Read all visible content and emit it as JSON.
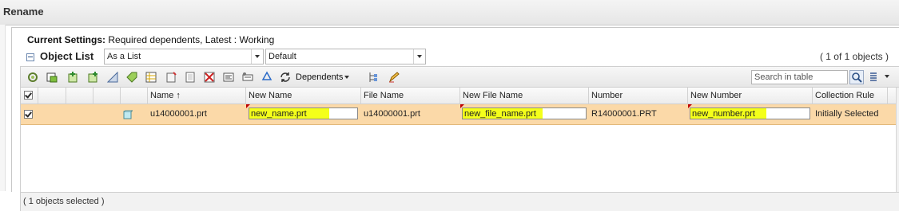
{
  "window": {
    "title": "Rename"
  },
  "settings": {
    "label": "Current Settings:",
    "value": "Required dependents, Latest : Working"
  },
  "object_list": {
    "title": "Object List",
    "view_select": "As a List",
    "filter_select": "Default",
    "count": "( 1 of 1 objects )"
  },
  "toolbar": {
    "dependents_label": "Dependents",
    "search_placeholder": "Search in table",
    "icons": [
      "gear-refresh-icon",
      "add-object-icon",
      "add-green-icon",
      "add-green-alt-icon",
      "edit-triangle-icon",
      "tag-icon",
      "table-list-icon",
      "remove-icon",
      "clear-icon",
      "remove-red-icon",
      "properties-icon",
      "recycle-icon",
      "refresh-icon",
      "tree-icon",
      "edit-pen-icon",
      "search-icon",
      "column-config-icon"
    ]
  },
  "table": {
    "columns": [
      "",
      "",
      "",
      "",
      "",
      "Name",
      "New Name",
      "File Name",
      "New File Name",
      "Number",
      "New Number",
      "Collection Rule"
    ],
    "sort_indicator": "↑",
    "rows": [
      {
        "selected": true,
        "name": "u14000001.prt",
        "new_name": "new_name.prt",
        "file_name": "u14000001.prt",
        "new_file_name": "new_file_name.prt",
        "number": "R14000001.PRT",
        "new_number": "new_number.prt",
        "collection_rule": "Initially Selected"
      }
    ],
    "highlight_color": "#f4ff1a",
    "row_selected_color": "#fbd9a8"
  },
  "status": {
    "text": "( 1 objects selected )"
  }
}
